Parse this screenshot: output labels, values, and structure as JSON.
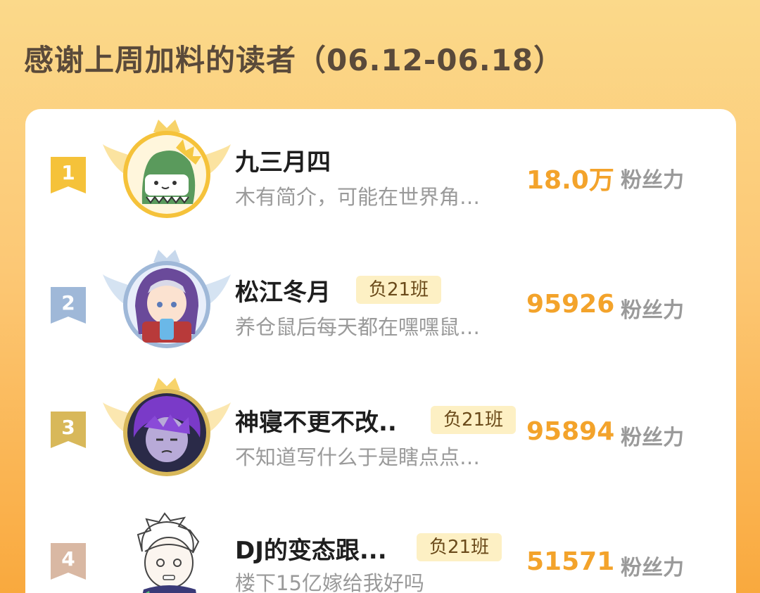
{
  "header": {
    "title": "感谢上周加料的读者（06.12-06.18）"
  },
  "colors": {
    "rank1": "#f5c23a",
    "rank2": "#9fb8d8",
    "rank3": "#d8b85a",
    "rank4": "#d9b8a3",
    "score": "#f3a32b",
    "badge_bg": "#fdf0c4"
  },
  "ranking": [
    {
      "rank": "1",
      "name": "九三月四",
      "badge": "",
      "intro": "木有简介，可能在世界角…",
      "score": "18.0万",
      "unit": "粉丝力",
      "avatar_icon": "dinosaur-avatar-icon"
    },
    {
      "rank": "2",
      "name": "松江冬月",
      "badge": "负21班",
      "intro": "养仓鼠后每天都在嘿嘿鼠…",
      "score": "95926",
      "unit": "粉丝力",
      "avatar_icon": "anime-girl-avatar-icon"
    },
    {
      "rank": "3",
      "name": "神寝不更不改..",
      "badge": "负21班",
      "intro": "不知道写什么于是瞎点点…",
      "score": "95894",
      "unit": "粉丝力",
      "avatar_icon": "purple-hair-avatar-icon"
    },
    {
      "rank": "4",
      "name": "DJ的变态跟...",
      "badge": "负21班",
      "intro": "楼下15亿嫁给我好吗",
      "score": "51571",
      "unit": "粉丝力",
      "avatar_icon": "sketch-character-avatar-icon"
    }
  ]
}
